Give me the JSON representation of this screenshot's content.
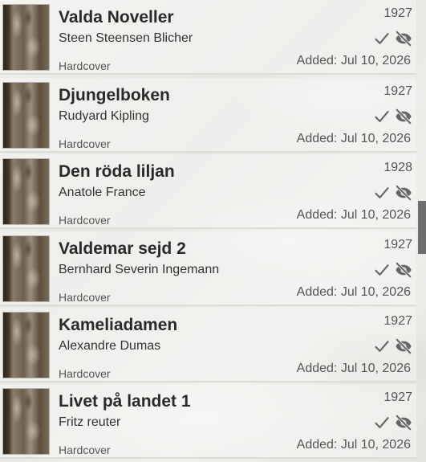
{
  "books": [
    {
      "title": "Valda Noveller",
      "author": "Steen Steensen Blicher",
      "format": "Hardcover",
      "year": "1927",
      "added": "Added: Jul 10, 2026"
    },
    {
      "title": "Djungelboken",
      "author": "Rudyard Kipling",
      "format": "Hardcover",
      "year": "1927",
      "added": "Added: Jul 10, 2026"
    },
    {
      "title": "Den röda liljan",
      "author": "Anatole France",
      "format": "Hardcover",
      "year": "1928",
      "added": "Added: Jul 10, 2026"
    },
    {
      "title": "Valdemar sejd 2",
      "author": "Bernhard Severin Ingemann",
      "format": "Hardcover",
      "year": "1927",
      "added": "Added: Jul 10, 2026"
    },
    {
      "title": "Kameliadamen",
      "author": "Alexandre Dumas",
      "format": "Hardcover",
      "year": "1927",
      "added": "Added: Jul 10, 2026"
    },
    {
      "title": "Livet på landet 1",
      "author": "Fritz reuter",
      "format": "Hardcover",
      "year": "1927",
      "added": "Added: Jul 10, 2026"
    }
  ],
  "icons": {
    "read": "check-icon",
    "hidden": "eye-off-icon"
  },
  "colors": {
    "icon": "#666666",
    "title": "#2a2a2a",
    "scrollbar": "#6e6e6e"
  }
}
